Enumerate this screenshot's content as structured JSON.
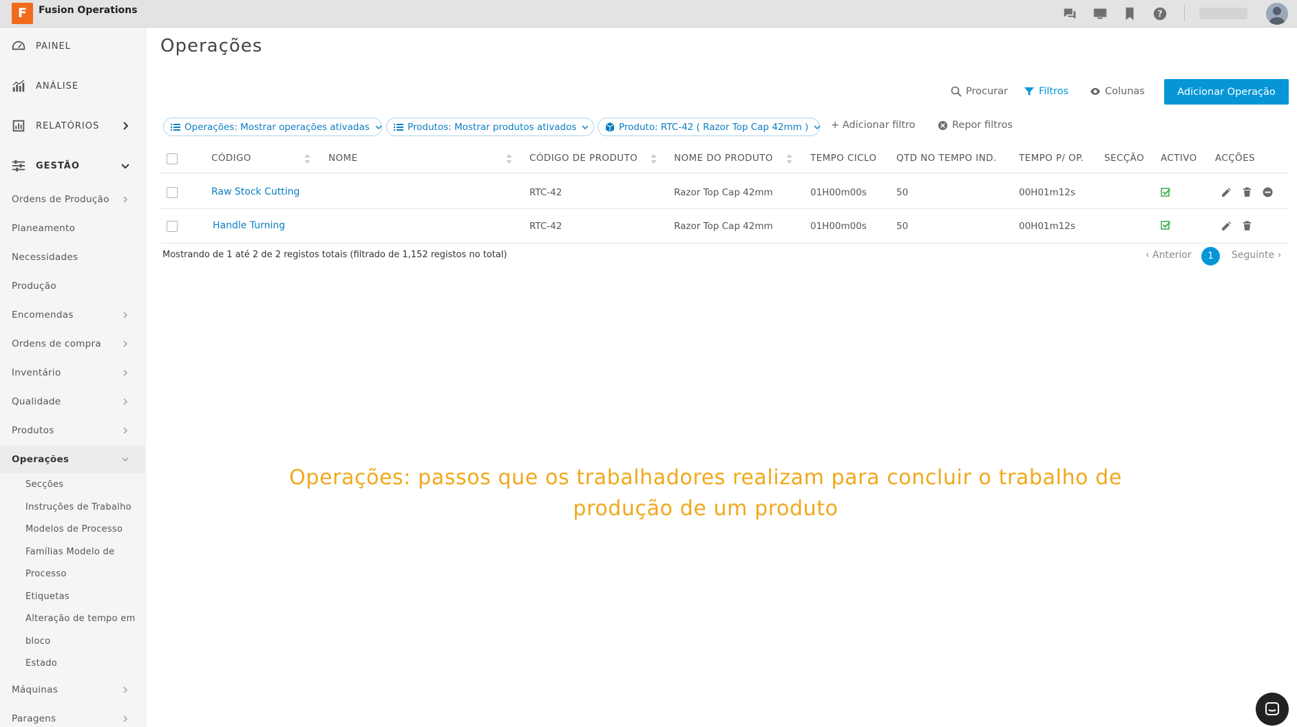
{
  "app": {
    "name": "Fusion Operations",
    "logo_letter": "F"
  },
  "topbar": {
    "icons": [
      "chat-icon",
      "monitor-icon",
      "bookmark-icon",
      "help-icon"
    ],
    "user_avatar": "avatar"
  },
  "sidebar": {
    "main": [
      {
        "label": "PAINEL",
        "icon": "dashboard-icon"
      },
      {
        "label": "ANÁLISE",
        "icon": "analytics-icon"
      },
      {
        "label": "RELATÓRIOS",
        "icon": "reports-icon"
      },
      {
        "label": "GESTÃO",
        "icon": "settings-sliders-icon"
      }
    ],
    "items": [
      "Ordens de Produção",
      "Planeamento",
      "Necessidades",
      "Produção",
      "Encomendas",
      "Ordens de compra",
      "Inventário",
      "Qualidade",
      "Produtos",
      "Operações"
    ],
    "sub_items": [
      "Secções",
      "Instruções de Trabalho",
      "Modelos de Processo",
      "Famílias Modelo de",
      "Processo",
      "Etiquetas",
      "Alteração de tempo em",
      "bloco",
      "Estado"
    ],
    "after_items": [
      "Máquinas",
      "Paragens"
    ]
  },
  "page": {
    "title": "Operações",
    "toolbar": {
      "search": "Procurar",
      "filters": "Filtros",
      "columns": "Colunas",
      "add": "Adicionar Operação"
    },
    "filters": [
      "Operações: Mostrar operações ativadas",
      "Produtos: Mostrar produtos ativados",
      "Produto: RTC-42 ( Razor Top Cap 42mm )"
    ],
    "add_filter": "+ Adicionar filtro",
    "reset_filters": "Repor filtros",
    "table": {
      "headers": [
        "CÓDIGO",
        "NOME",
        "CÓDIGO DE PRODUTO",
        "NOME DO PRODUTO",
        "TEMPO CICLO",
        "QTD NO TEMPO IND.",
        "TEMPO P/ OP.",
        "SECÇÃO",
        "ACTIVO",
        "ACÇÕES"
      ],
      "rows": [
        {
          "code": "Raw Stock Cutting",
          "name": "",
          "product_code": "RTC-42",
          "product_name": "Razor Top Cap 42mm",
          "cycle_time": "01H00m00s",
          "qty": "50",
          "time_per_op": "00H01m12s",
          "section": "",
          "active": true
        },
        {
          "code": "Handle Turning",
          "name": "",
          "product_code": "RTC-42",
          "product_name": "Razor Top Cap 42mm",
          "cycle_time": "01H00m00s",
          "qty": "50",
          "time_per_op": "00H01m12s",
          "section": "",
          "active": true
        }
      ]
    },
    "footer": {
      "info": "Mostrando de 1 até 2 de 2 registos totais (filtrado de 1,152 registos no total)",
      "prev": "‹ Anterior",
      "page": "1",
      "next": "Seguinte ›"
    }
  },
  "caption": "Operações: passos que os trabalhadores realizam para concluir o trabalho de produção de um produto",
  "colors": {
    "accent": "#0696d7",
    "caption": "#f0a81c",
    "logo": "#f26b1d",
    "active_check": "#3cb054"
  }
}
